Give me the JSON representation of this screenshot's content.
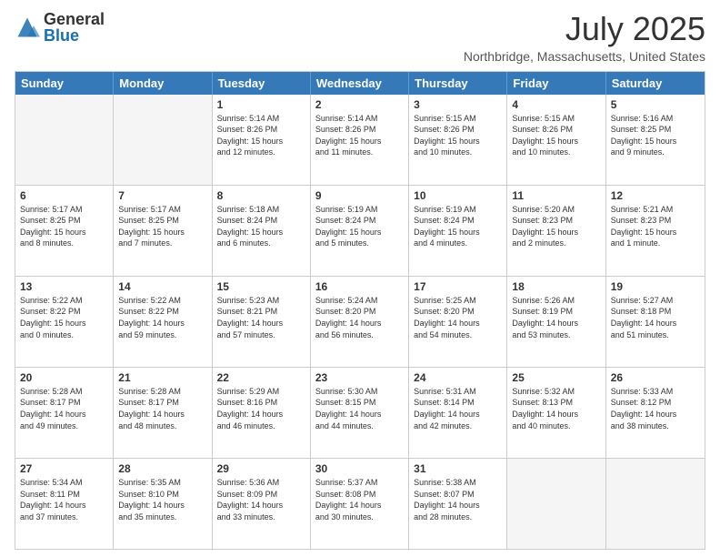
{
  "header": {
    "logo_general": "General",
    "logo_blue": "Blue",
    "month_title": "July 2025",
    "location": "Northbridge, Massachusetts, United States"
  },
  "days_of_week": [
    "Sunday",
    "Monday",
    "Tuesday",
    "Wednesday",
    "Thursday",
    "Friday",
    "Saturday"
  ],
  "weeks": [
    [
      {
        "day": "",
        "empty": true
      },
      {
        "day": "",
        "empty": true
      },
      {
        "day": "1",
        "l1": "Sunrise: 5:14 AM",
        "l2": "Sunset: 8:26 PM",
        "l3": "Daylight: 15 hours",
        "l4": "and 12 minutes."
      },
      {
        "day": "2",
        "l1": "Sunrise: 5:14 AM",
        "l2": "Sunset: 8:26 PM",
        "l3": "Daylight: 15 hours",
        "l4": "and 11 minutes."
      },
      {
        "day": "3",
        "l1": "Sunrise: 5:15 AM",
        "l2": "Sunset: 8:26 PM",
        "l3": "Daylight: 15 hours",
        "l4": "and 10 minutes."
      },
      {
        "day": "4",
        "l1": "Sunrise: 5:15 AM",
        "l2": "Sunset: 8:26 PM",
        "l3": "Daylight: 15 hours",
        "l4": "and 10 minutes."
      },
      {
        "day": "5",
        "l1": "Sunrise: 5:16 AM",
        "l2": "Sunset: 8:25 PM",
        "l3": "Daylight: 15 hours",
        "l4": "and 9 minutes."
      }
    ],
    [
      {
        "day": "6",
        "l1": "Sunrise: 5:17 AM",
        "l2": "Sunset: 8:25 PM",
        "l3": "Daylight: 15 hours",
        "l4": "and 8 minutes."
      },
      {
        "day": "7",
        "l1": "Sunrise: 5:17 AM",
        "l2": "Sunset: 8:25 PM",
        "l3": "Daylight: 15 hours",
        "l4": "and 7 minutes."
      },
      {
        "day": "8",
        "l1": "Sunrise: 5:18 AM",
        "l2": "Sunset: 8:24 PM",
        "l3": "Daylight: 15 hours",
        "l4": "and 6 minutes."
      },
      {
        "day": "9",
        "l1": "Sunrise: 5:19 AM",
        "l2": "Sunset: 8:24 PM",
        "l3": "Daylight: 15 hours",
        "l4": "and 5 minutes."
      },
      {
        "day": "10",
        "l1": "Sunrise: 5:19 AM",
        "l2": "Sunset: 8:24 PM",
        "l3": "Daylight: 15 hours",
        "l4": "and 4 minutes."
      },
      {
        "day": "11",
        "l1": "Sunrise: 5:20 AM",
        "l2": "Sunset: 8:23 PM",
        "l3": "Daylight: 15 hours",
        "l4": "and 2 minutes."
      },
      {
        "day": "12",
        "l1": "Sunrise: 5:21 AM",
        "l2": "Sunset: 8:23 PM",
        "l3": "Daylight: 15 hours",
        "l4": "and 1 minute."
      }
    ],
    [
      {
        "day": "13",
        "l1": "Sunrise: 5:22 AM",
        "l2": "Sunset: 8:22 PM",
        "l3": "Daylight: 15 hours",
        "l4": "and 0 minutes."
      },
      {
        "day": "14",
        "l1": "Sunrise: 5:22 AM",
        "l2": "Sunset: 8:22 PM",
        "l3": "Daylight: 14 hours",
        "l4": "and 59 minutes."
      },
      {
        "day": "15",
        "l1": "Sunrise: 5:23 AM",
        "l2": "Sunset: 8:21 PM",
        "l3": "Daylight: 14 hours",
        "l4": "and 57 minutes."
      },
      {
        "day": "16",
        "l1": "Sunrise: 5:24 AM",
        "l2": "Sunset: 8:20 PM",
        "l3": "Daylight: 14 hours",
        "l4": "and 56 minutes."
      },
      {
        "day": "17",
        "l1": "Sunrise: 5:25 AM",
        "l2": "Sunset: 8:20 PM",
        "l3": "Daylight: 14 hours",
        "l4": "and 54 minutes."
      },
      {
        "day": "18",
        "l1": "Sunrise: 5:26 AM",
        "l2": "Sunset: 8:19 PM",
        "l3": "Daylight: 14 hours",
        "l4": "and 53 minutes."
      },
      {
        "day": "19",
        "l1": "Sunrise: 5:27 AM",
        "l2": "Sunset: 8:18 PM",
        "l3": "Daylight: 14 hours",
        "l4": "and 51 minutes."
      }
    ],
    [
      {
        "day": "20",
        "l1": "Sunrise: 5:28 AM",
        "l2": "Sunset: 8:17 PM",
        "l3": "Daylight: 14 hours",
        "l4": "and 49 minutes."
      },
      {
        "day": "21",
        "l1": "Sunrise: 5:28 AM",
        "l2": "Sunset: 8:17 PM",
        "l3": "Daylight: 14 hours",
        "l4": "and 48 minutes."
      },
      {
        "day": "22",
        "l1": "Sunrise: 5:29 AM",
        "l2": "Sunset: 8:16 PM",
        "l3": "Daylight: 14 hours",
        "l4": "and 46 minutes."
      },
      {
        "day": "23",
        "l1": "Sunrise: 5:30 AM",
        "l2": "Sunset: 8:15 PM",
        "l3": "Daylight: 14 hours",
        "l4": "and 44 minutes."
      },
      {
        "day": "24",
        "l1": "Sunrise: 5:31 AM",
        "l2": "Sunset: 8:14 PM",
        "l3": "Daylight: 14 hours",
        "l4": "and 42 minutes."
      },
      {
        "day": "25",
        "l1": "Sunrise: 5:32 AM",
        "l2": "Sunset: 8:13 PM",
        "l3": "Daylight: 14 hours",
        "l4": "and 40 minutes."
      },
      {
        "day": "26",
        "l1": "Sunrise: 5:33 AM",
        "l2": "Sunset: 8:12 PM",
        "l3": "Daylight: 14 hours",
        "l4": "and 38 minutes."
      }
    ],
    [
      {
        "day": "27",
        "l1": "Sunrise: 5:34 AM",
        "l2": "Sunset: 8:11 PM",
        "l3": "Daylight: 14 hours",
        "l4": "and 37 minutes."
      },
      {
        "day": "28",
        "l1": "Sunrise: 5:35 AM",
        "l2": "Sunset: 8:10 PM",
        "l3": "Daylight: 14 hours",
        "l4": "and 35 minutes."
      },
      {
        "day": "29",
        "l1": "Sunrise: 5:36 AM",
        "l2": "Sunset: 8:09 PM",
        "l3": "Daylight: 14 hours",
        "l4": "and 33 minutes."
      },
      {
        "day": "30",
        "l1": "Sunrise: 5:37 AM",
        "l2": "Sunset: 8:08 PM",
        "l3": "Daylight: 14 hours",
        "l4": "and 30 minutes."
      },
      {
        "day": "31",
        "l1": "Sunrise: 5:38 AM",
        "l2": "Sunset: 8:07 PM",
        "l3": "Daylight: 14 hours",
        "l4": "and 28 minutes."
      },
      {
        "day": "",
        "empty": true
      },
      {
        "day": "",
        "empty": true
      }
    ]
  ]
}
